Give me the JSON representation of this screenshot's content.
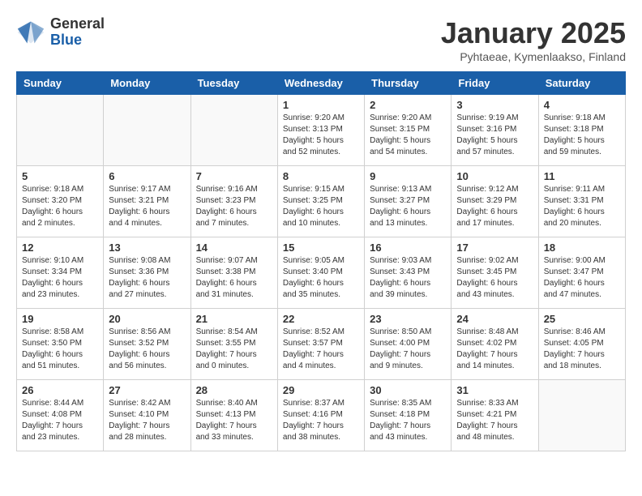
{
  "header": {
    "logo_general": "General",
    "logo_blue": "Blue",
    "title": "January 2025",
    "subtitle": "Pyhtaeae, Kymenlaakso, Finland"
  },
  "weekdays": [
    "Sunday",
    "Monday",
    "Tuesday",
    "Wednesday",
    "Thursday",
    "Friday",
    "Saturday"
  ],
  "weeks": [
    [
      {
        "day": "",
        "info": ""
      },
      {
        "day": "",
        "info": ""
      },
      {
        "day": "",
        "info": ""
      },
      {
        "day": "1",
        "info": "Sunrise: 9:20 AM\nSunset: 3:13 PM\nDaylight: 5 hours\nand 52 minutes."
      },
      {
        "day": "2",
        "info": "Sunrise: 9:20 AM\nSunset: 3:15 PM\nDaylight: 5 hours\nand 54 minutes."
      },
      {
        "day": "3",
        "info": "Sunrise: 9:19 AM\nSunset: 3:16 PM\nDaylight: 5 hours\nand 57 minutes."
      },
      {
        "day": "4",
        "info": "Sunrise: 9:18 AM\nSunset: 3:18 PM\nDaylight: 5 hours\nand 59 minutes."
      }
    ],
    [
      {
        "day": "5",
        "info": "Sunrise: 9:18 AM\nSunset: 3:20 PM\nDaylight: 6 hours\nand 2 minutes."
      },
      {
        "day": "6",
        "info": "Sunrise: 9:17 AM\nSunset: 3:21 PM\nDaylight: 6 hours\nand 4 minutes."
      },
      {
        "day": "7",
        "info": "Sunrise: 9:16 AM\nSunset: 3:23 PM\nDaylight: 6 hours\nand 7 minutes."
      },
      {
        "day": "8",
        "info": "Sunrise: 9:15 AM\nSunset: 3:25 PM\nDaylight: 6 hours\nand 10 minutes."
      },
      {
        "day": "9",
        "info": "Sunrise: 9:13 AM\nSunset: 3:27 PM\nDaylight: 6 hours\nand 13 minutes."
      },
      {
        "day": "10",
        "info": "Sunrise: 9:12 AM\nSunset: 3:29 PM\nDaylight: 6 hours\nand 17 minutes."
      },
      {
        "day": "11",
        "info": "Sunrise: 9:11 AM\nSunset: 3:31 PM\nDaylight: 6 hours\nand 20 minutes."
      }
    ],
    [
      {
        "day": "12",
        "info": "Sunrise: 9:10 AM\nSunset: 3:34 PM\nDaylight: 6 hours\nand 23 minutes."
      },
      {
        "day": "13",
        "info": "Sunrise: 9:08 AM\nSunset: 3:36 PM\nDaylight: 6 hours\nand 27 minutes."
      },
      {
        "day": "14",
        "info": "Sunrise: 9:07 AM\nSunset: 3:38 PM\nDaylight: 6 hours\nand 31 minutes."
      },
      {
        "day": "15",
        "info": "Sunrise: 9:05 AM\nSunset: 3:40 PM\nDaylight: 6 hours\nand 35 minutes."
      },
      {
        "day": "16",
        "info": "Sunrise: 9:03 AM\nSunset: 3:43 PM\nDaylight: 6 hours\nand 39 minutes."
      },
      {
        "day": "17",
        "info": "Sunrise: 9:02 AM\nSunset: 3:45 PM\nDaylight: 6 hours\nand 43 minutes."
      },
      {
        "day": "18",
        "info": "Sunrise: 9:00 AM\nSunset: 3:47 PM\nDaylight: 6 hours\nand 47 minutes."
      }
    ],
    [
      {
        "day": "19",
        "info": "Sunrise: 8:58 AM\nSunset: 3:50 PM\nDaylight: 6 hours\nand 51 minutes."
      },
      {
        "day": "20",
        "info": "Sunrise: 8:56 AM\nSunset: 3:52 PM\nDaylight: 6 hours\nand 56 minutes."
      },
      {
        "day": "21",
        "info": "Sunrise: 8:54 AM\nSunset: 3:55 PM\nDaylight: 7 hours\nand 0 minutes."
      },
      {
        "day": "22",
        "info": "Sunrise: 8:52 AM\nSunset: 3:57 PM\nDaylight: 7 hours\nand 4 minutes."
      },
      {
        "day": "23",
        "info": "Sunrise: 8:50 AM\nSunset: 4:00 PM\nDaylight: 7 hours\nand 9 minutes."
      },
      {
        "day": "24",
        "info": "Sunrise: 8:48 AM\nSunset: 4:02 PM\nDaylight: 7 hours\nand 14 minutes."
      },
      {
        "day": "25",
        "info": "Sunrise: 8:46 AM\nSunset: 4:05 PM\nDaylight: 7 hours\nand 18 minutes."
      }
    ],
    [
      {
        "day": "26",
        "info": "Sunrise: 8:44 AM\nSunset: 4:08 PM\nDaylight: 7 hours\nand 23 minutes."
      },
      {
        "day": "27",
        "info": "Sunrise: 8:42 AM\nSunset: 4:10 PM\nDaylight: 7 hours\nand 28 minutes."
      },
      {
        "day": "28",
        "info": "Sunrise: 8:40 AM\nSunset: 4:13 PM\nDaylight: 7 hours\nand 33 minutes."
      },
      {
        "day": "29",
        "info": "Sunrise: 8:37 AM\nSunset: 4:16 PM\nDaylight: 7 hours\nand 38 minutes."
      },
      {
        "day": "30",
        "info": "Sunrise: 8:35 AM\nSunset: 4:18 PM\nDaylight: 7 hours\nand 43 minutes."
      },
      {
        "day": "31",
        "info": "Sunrise: 8:33 AM\nSunset: 4:21 PM\nDaylight: 7 hours\nand 48 minutes."
      },
      {
        "day": "",
        "info": ""
      }
    ]
  ]
}
